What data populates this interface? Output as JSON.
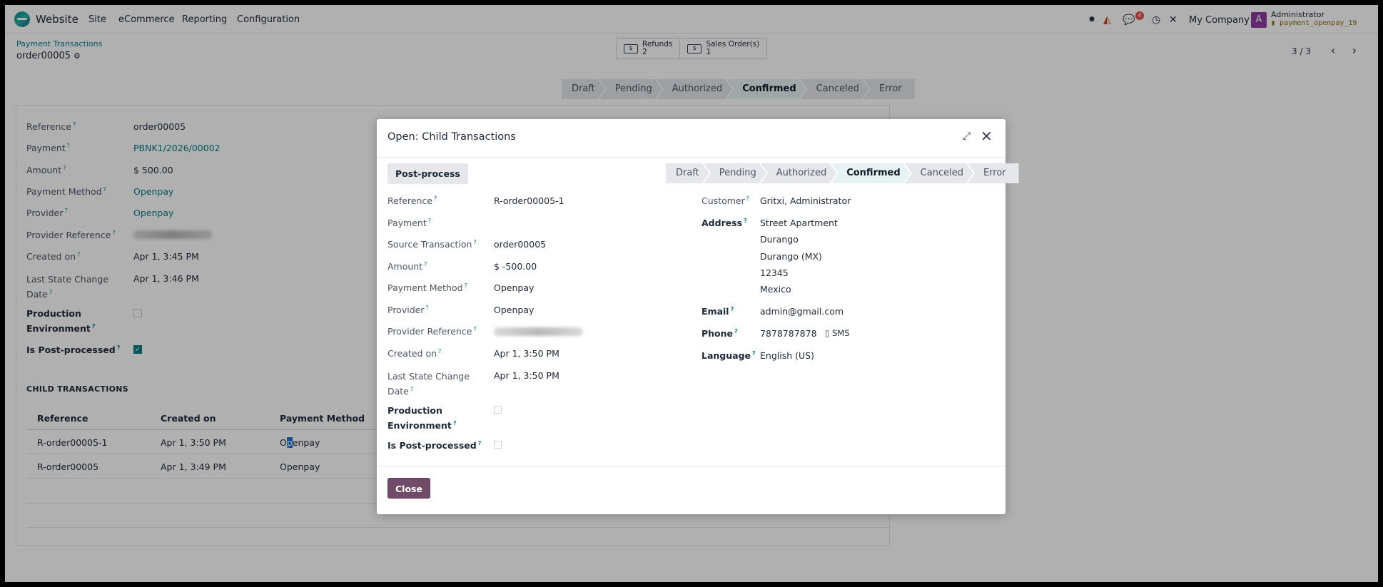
{
  "navbar": {
    "app_name": "Website",
    "menu": [
      "Site",
      "eCommerce",
      "Reporting",
      "Configuration"
    ],
    "notification_count": "4",
    "company": "My Company",
    "user_initial": "A",
    "user_name": "Administrator",
    "db_name": "payment_openpay_19",
    "icons": [
      "bug-icon",
      "chart-icon",
      "chat-icon",
      "clock-icon",
      "tools-icon"
    ]
  },
  "control": {
    "breadcrumb": "Payment Transactions",
    "record": "order00005",
    "smart_buttons": [
      {
        "label": "Refunds",
        "count": "2"
      },
      {
        "label": "Sales Order(s)",
        "count": "1"
      }
    ],
    "pager": "3 / 3"
  },
  "statusbar": [
    "Draft",
    "Pending",
    "Authorized",
    "Confirmed",
    "Canceled",
    "Error"
  ],
  "active_status": "Confirmed",
  "form": {
    "fields": [
      {
        "label": "Reference",
        "value": "order00005"
      },
      {
        "label": "Payment",
        "value": "PBNK1/2026/00002"
      },
      {
        "label": "Amount",
        "value": "$ 500.00"
      },
      {
        "label": "Payment Method",
        "value": "Openpay"
      },
      {
        "label": "Provider",
        "value": "Openpay"
      },
      {
        "label": "Provider Reference",
        "value": ""
      },
      {
        "label": "Created on",
        "value": "Apr 1, 3:45 PM"
      },
      {
        "label": "Last State Change",
        "label2": "Date",
        "value": "Apr 1, 3:46 PM"
      },
      {
        "label": "Production",
        "label2": "Environment",
        "value": ""
      },
      {
        "label": "Is Post-processed",
        "value": ""
      }
    ],
    "child_title": "CHILD TRANSACTIONS",
    "columns": [
      "Reference",
      "Created on",
      "Payment Method"
    ],
    "rows": [
      {
        "ref": "R-order00005-1",
        "created": "Apr 1, 3:50 PM",
        "method_a": "O",
        "method_sel": "p",
        "method_b": "enpay"
      },
      {
        "ref": "R-order00005",
        "created": "Apr 1, 3:49 PM",
        "method": "Openpay"
      }
    ]
  },
  "modal": {
    "title": "Open: Child Transactions",
    "post_process": "Post-process",
    "left": [
      {
        "label": "Reference",
        "value": "R-order00005-1"
      },
      {
        "label": "Payment",
        "value": ""
      },
      {
        "label": "Source Transaction",
        "value": "order00005"
      },
      {
        "label": "Amount",
        "value": "$ -500.00"
      },
      {
        "label": "Payment Method",
        "value": "Openpay"
      },
      {
        "label": "Provider",
        "value": "Openpay"
      },
      {
        "label": "Provider Reference",
        "value": ""
      },
      {
        "label": "Created on",
        "value": "Apr 1, 3:50 PM"
      },
      {
        "label": "Last State Change",
        "label2": "Date",
        "value": "Apr 1, 3:50 PM"
      },
      {
        "label": "Production",
        "label2": "Environment",
        "value": ""
      },
      {
        "label": "Is Post-processed",
        "value": ""
      }
    ],
    "right": {
      "customer_label": "Customer",
      "customer": "Gritxi, Administrator",
      "address_label": "Address",
      "address": [
        "Street Apartment",
        "Durango",
        "Durango (MX)",
        "12345",
        "Mexico"
      ],
      "email_label": "Email",
      "email": "admin@gmail.com",
      "phone_label": "Phone",
      "phone": "7878787878",
      "sms": "SMS",
      "language_label": "Language",
      "language": "English (US)"
    },
    "close": "Close"
  },
  "colors": {
    "accent": "#017e84",
    "primary_button": "#714b67",
    "avatar": "#8e3aa3",
    "badge": "#e54d4d"
  }
}
